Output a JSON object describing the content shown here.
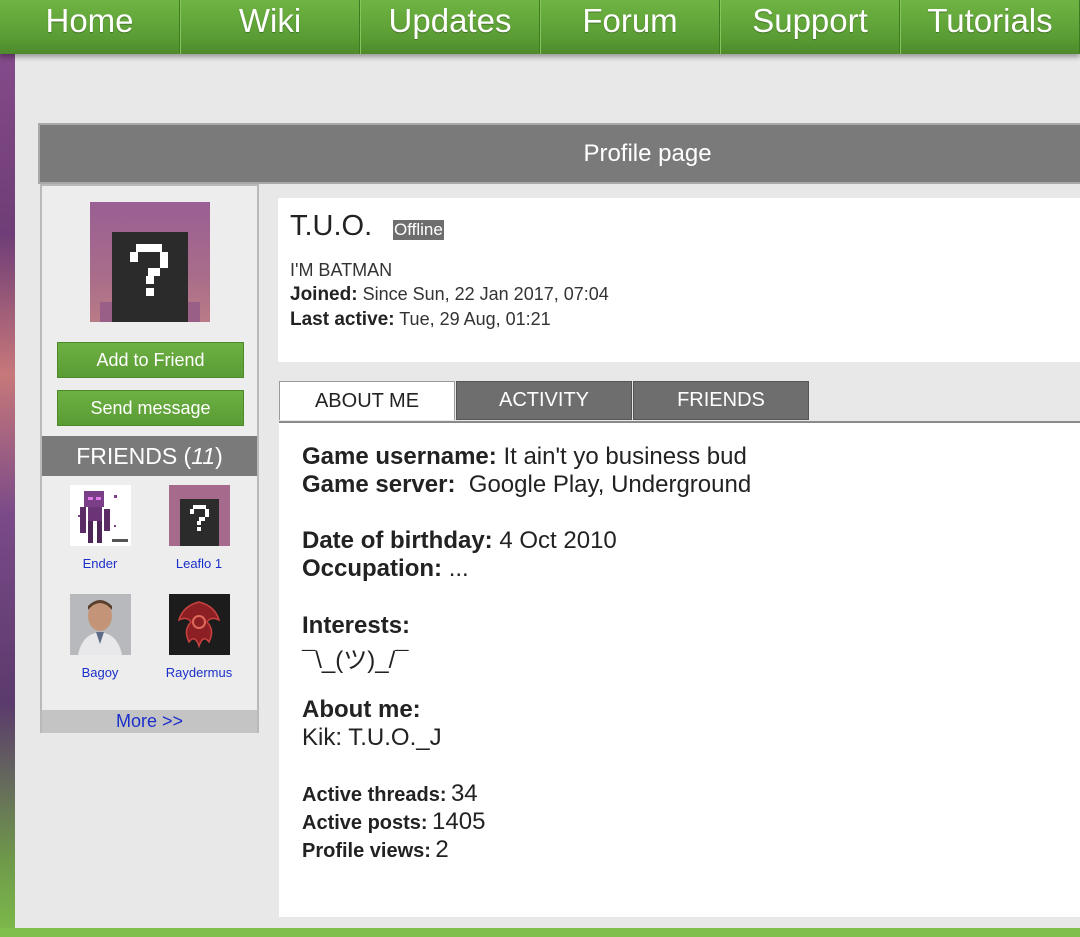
{
  "nav": {
    "items": [
      "Home",
      "Wiki",
      "Updates",
      "Forum",
      "Support",
      "Tutorials"
    ]
  },
  "page_title": "Profile page",
  "sidebar": {
    "add_friend_label": "Add to Friend",
    "send_message_label": "Send message",
    "friends_label": "FRIENDS (",
    "friends_count": "11",
    "friends_close": ")",
    "friends": [
      {
        "name": "Ender"
      },
      {
        "name": "Leaflo 1"
      },
      {
        "name": "Bagoy"
      },
      {
        "name": "Raydermus"
      }
    ],
    "more_label": "More >>"
  },
  "profile": {
    "username": "T.U.O.",
    "status": "Offline",
    "tagline": "I'M BATMAN",
    "joined_label": "Joined:",
    "joined_value": "Since Sun, 22 Jan 2017, 07:04",
    "last_active_label": "Last active:",
    "last_active_value": "Tue, 29 Aug, 01:21"
  },
  "tabs": [
    {
      "label": "ABOUT ME",
      "active": true
    },
    {
      "label": "ACTIVITY",
      "active": false
    },
    {
      "label": "FRIENDS",
      "active": false
    }
  ],
  "about": {
    "game_username_label": "Game username:",
    "game_username_value": "It ain't yo business bud",
    "game_server_label": "Game server:",
    "game_server_value": "Google Play, Underground",
    "birthday_label": "Date of birthday:",
    "birthday_value": "4 Oct 2010",
    "occupation_label": "Occupation:",
    "occupation_value": "...",
    "interests_label": "Interests:",
    "interests_value": "¯\\_(ツ)_/¯",
    "about_me_label": "About me:",
    "about_me_value": "Kik: T.U.O._J",
    "active_threads_label": "Active threads:",
    "active_threads_value": "34",
    "active_posts_label": "Active posts:",
    "active_posts_value": "1405",
    "profile_views_label": "Profile views:",
    "profile_views_value": "2"
  },
  "colors": {
    "nav_green": "#5a9c34",
    "header_gray": "#7a7a7a",
    "link_blue": "#1a2fc9"
  }
}
